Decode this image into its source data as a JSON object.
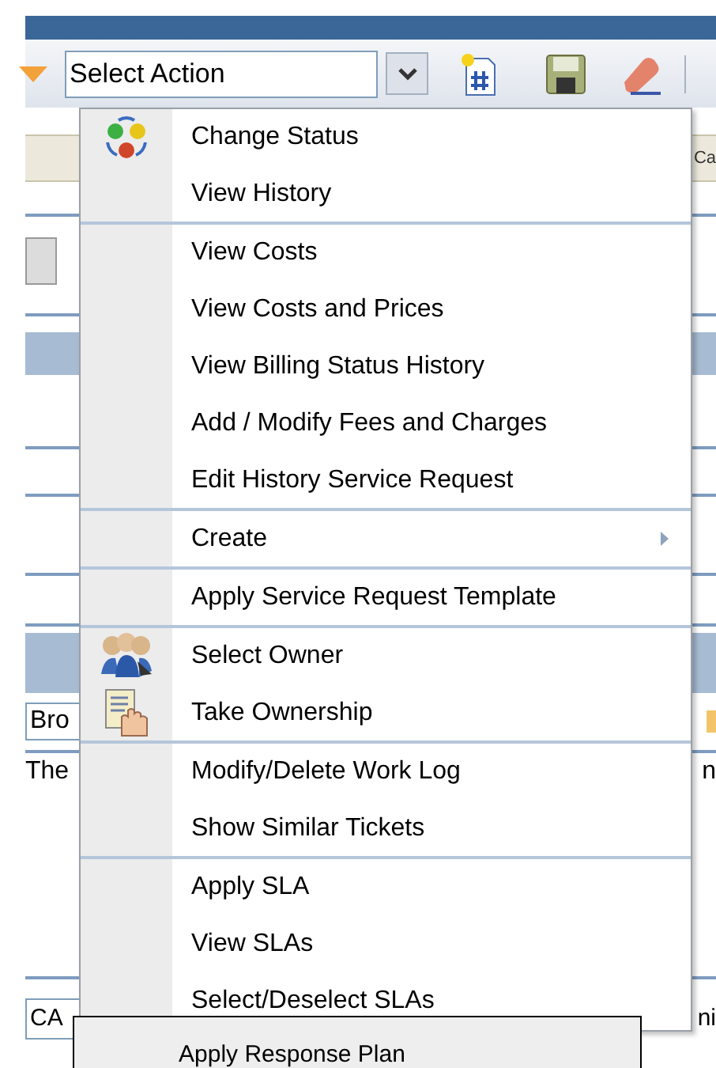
{
  "toolbar": {
    "action_select": {
      "value": "Select Action"
    }
  },
  "background": {
    "tab_fragment": "Ca",
    "field_fragment": "Bro",
    "text_fragment": "The",
    "right_fragment": "n",
    "bottom_field_fragment": "CA",
    "bottom_right_fragment": "ni"
  },
  "menu": {
    "items": [
      {
        "label": "Change Status",
        "kind": "status",
        "separator_after": false,
        "submenu": false
      },
      {
        "label": "View History",
        "kind": "plain",
        "separator_after": true,
        "submenu": false
      },
      {
        "label": "View Costs",
        "kind": "plain",
        "separator_after": false,
        "submenu": false
      },
      {
        "label": "View Costs and Prices",
        "kind": "plain",
        "separator_after": false,
        "submenu": false
      },
      {
        "label": "View Billing Status History",
        "kind": "plain",
        "separator_after": false,
        "submenu": false
      },
      {
        "label": "Add / Modify Fees and Charges",
        "kind": "plain",
        "separator_after": false,
        "submenu": false
      },
      {
        "label": "Edit History Service Request",
        "kind": "plain",
        "separator_after": true,
        "submenu": false
      },
      {
        "label": "Create",
        "kind": "plain",
        "separator_after": true,
        "submenu": true
      },
      {
        "label": "Apply Service Request Template",
        "kind": "plain",
        "separator_after": true,
        "submenu": false
      },
      {
        "label": "Select Owner",
        "kind": "people",
        "separator_after": false,
        "submenu": false
      },
      {
        "label": "Take Ownership",
        "kind": "document-hand",
        "separator_after": true,
        "submenu": false
      },
      {
        "label": "Modify/Delete Work Log",
        "kind": "plain",
        "separator_after": false,
        "submenu": false
      },
      {
        "label": "Show Similar Tickets",
        "kind": "plain",
        "separator_after": true,
        "submenu": false
      },
      {
        "label": "Apply SLA",
        "kind": "plain",
        "separator_after": false,
        "submenu": false
      },
      {
        "label": "View SLAs",
        "kind": "plain",
        "separator_after": false,
        "submenu": false
      },
      {
        "label": "Select/Deselect SLAs",
        "kind": "plain",
        "separator_after": false,
        "submenu": false
      }
    ]
  },
  "hover_item": {
    "label": "Apply Response Plan"
  }
}
